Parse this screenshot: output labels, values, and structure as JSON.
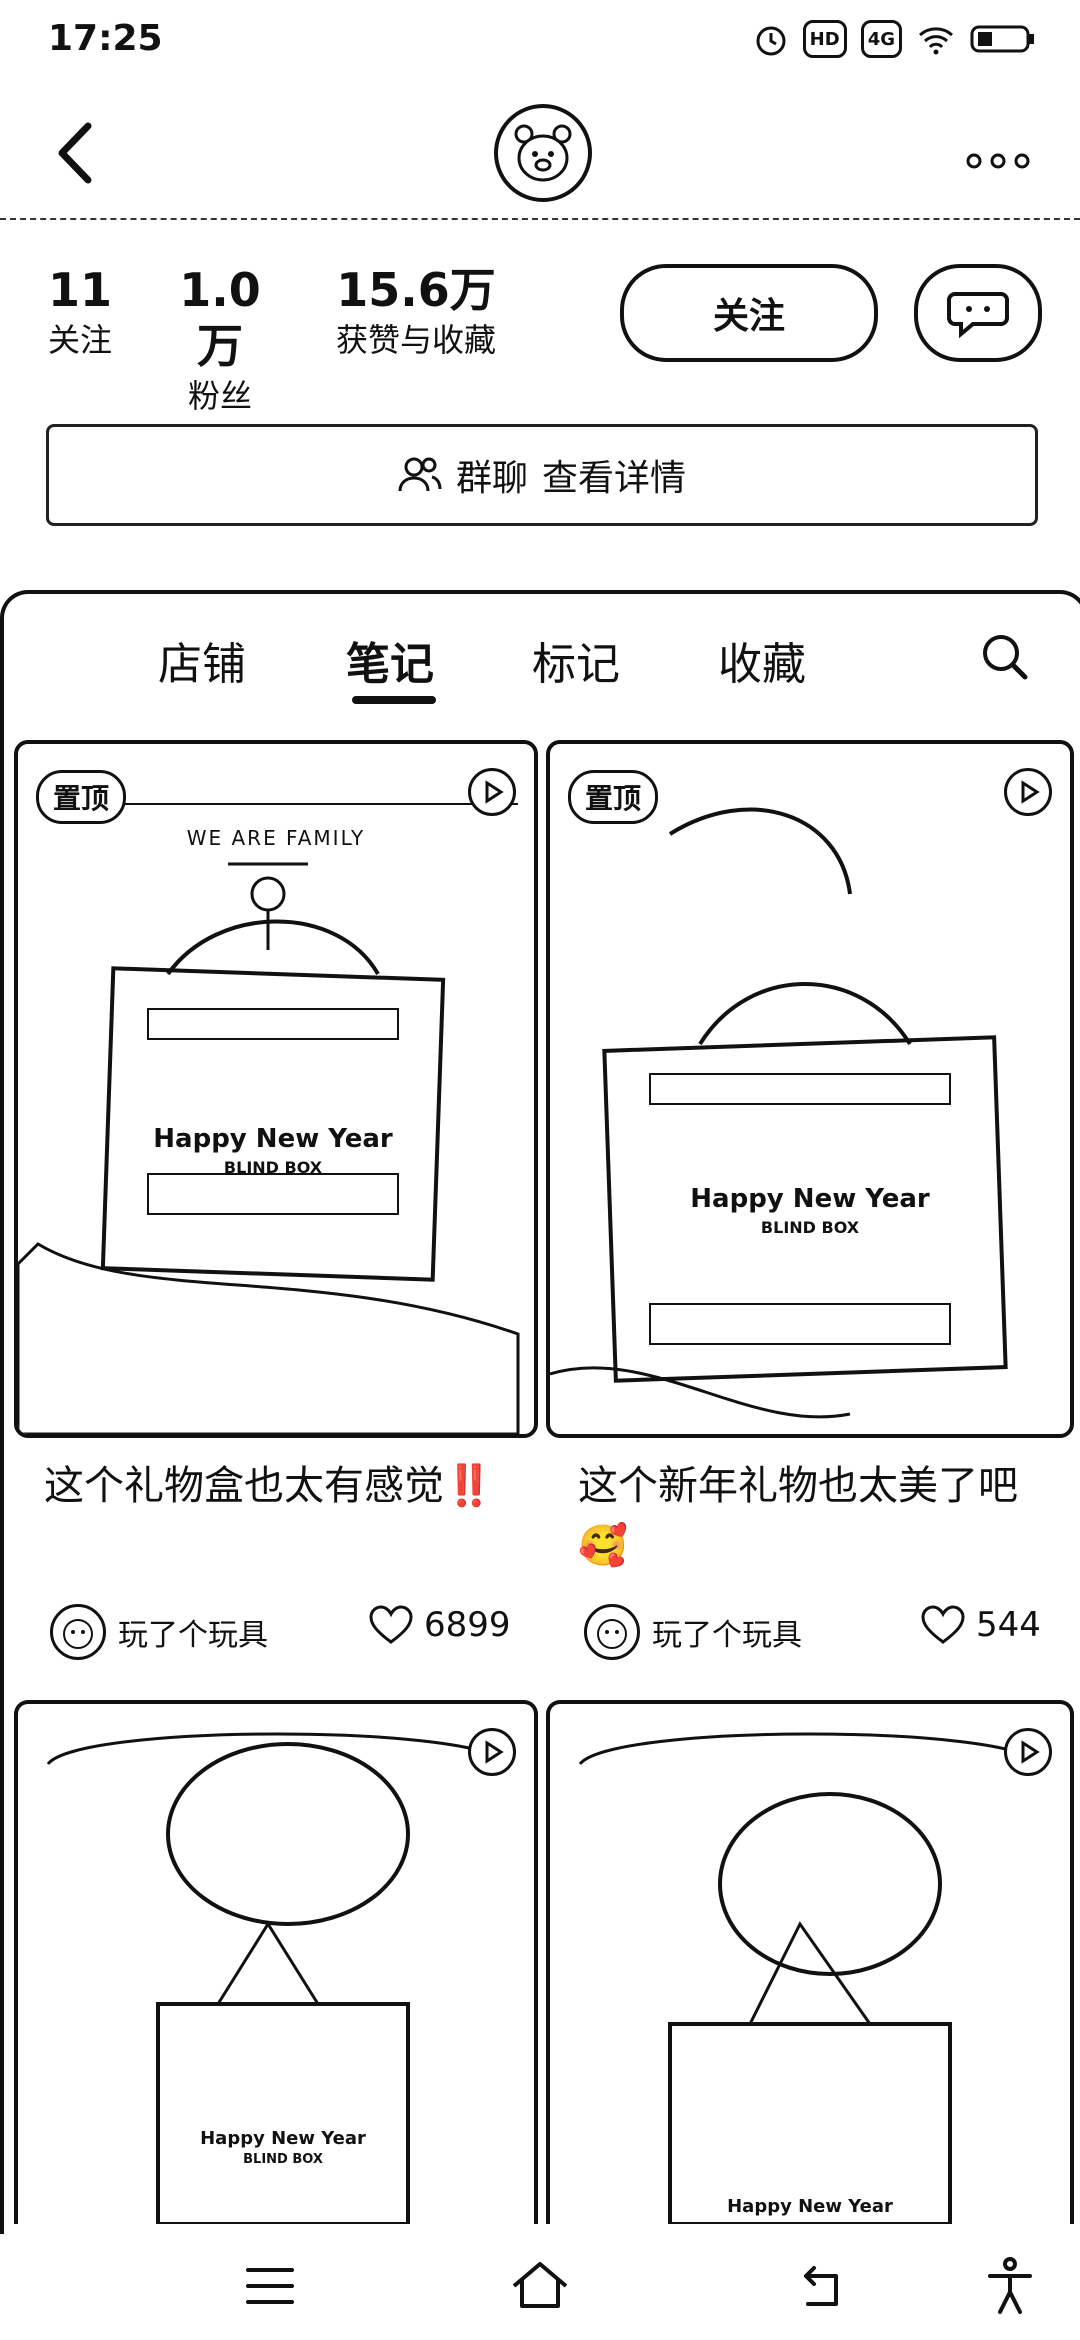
{
  "status_bar": {
    "time": "17:25",
    "icons": [
      "alarm-icon",
      "hd-icon",
      "signal-4g-icon",
      "wifi-icon",
      "battery-icon"
    ],
    "hd_label": "HD",
    "net_label": "4G"
  },
  "header": {
    "back_icon": "chevron-left-icon",
    "avatar_icon": "bear-avatar-icon",
    "more_icon": "more-dots-icon"
  },
  "profile": {
    "stats": [
      {
        "value": "11",
        "label": "关注"
      },
      {
        "value": "1.0万",
        "label": "粉丝"
      },
      {
        "value": "15.6万",
        "label": "获赞与收藏"
      }
    ],
    "follow_label": "关注",
    "message_icon": "chat-bubble-icon",
    "group_chat_label": "群聊",
    "group_detail_label": "查看详情"
  },
  "tabs": [
    {
      "label": "店铺",
      "active": false
    },
    {
      "label": "笔记",
      "active": true
    },
    {
      "label": "标记",
      "active": false
    },
    {
      "label": "收藏",
      "active": false
    }
  ],
  "notes": [
    {
      "pinned": true,
      "pin_label": "置顶",
      "is_video": true,
      "image_text": [
        "WE ARE FAMILY",
        "Happy New Year",
        "BLIND BOX"
      ],
      "title": "这个礼物盒也太有感觉‼️",
      "author": "玩了个玩具",
      "likes": "6899"
    },
    {
      "pinned": true,
      "pin_label": "置顶",
      "is_video": true,
      "image_text": [
        "Happy New Year",
        "BLIND BOX"
      ],
      "title": "这个新年礼物也太美了吧🥰",
      "author": "玩了个玩具",
      "likes": "544"
    },
    {
      "pinned": false,
      "is_video": true,
      "image_text": [
        "Happy New Year",
        "BLIND BOX"
      ]
    },
    {
      "pinned": false,
      "is_video": true,
      "image_text": [
        "Happy New Year"
      ]
    }
  ],
  "bottom_nav": [
    {
      "icon": "menu-icon"
    },
    {
      "icon": "home-icon"
    },
    {
      "icon": "back-icon"
    },
    {
      "icon": "accessibility-icon"
    }
  ]
}
